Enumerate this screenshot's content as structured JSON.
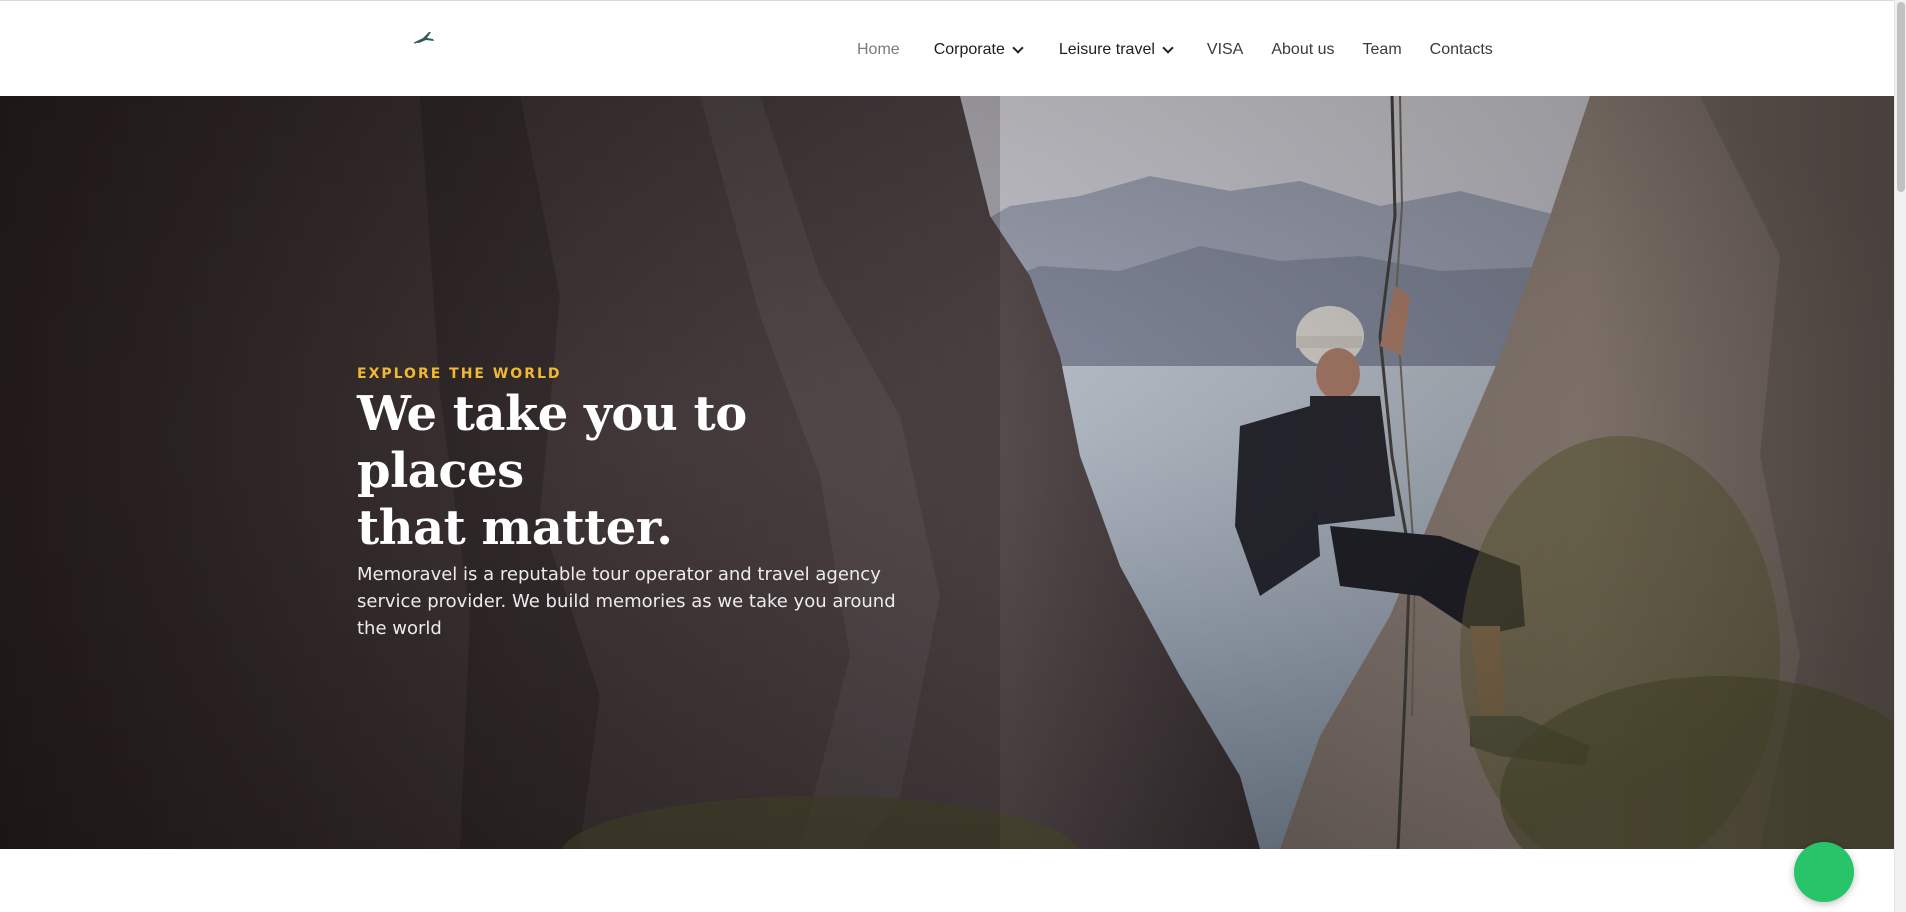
{
  "nav": {
    "items": [
      {
        "label": "Home",
        "active": true
      },
      {
        "label": "Corporate",
        "has_dropdown": true
      },
      {
        "label": "Leisure travel",
        "has_dropdown": true
      },
      {
        "label": "VISA"
      },
      {
        "label": "About us"
      },
      {
        "label": "Team"
      },
      {
        "label": "Contacts"
      }
    ]
  },
  "logo": {
    "icon": "airplane-logo-icon",
    "color": "#2e5e57"
  },
  "hero": {
    "kicker": "EXPLORE THE WORLD",
    "headline_line1": "We take you to places",
    "headline_line2": "that matter.",
    "description": "Memoravel is a reputable tour operator and travel agency service provider. We build memories as we take you around the world",
    "kicker_color": "#f0b933"
  },
  "chat_button": {
    "icon": "chat-bubble-icon",
    "color": "#27c46a"
  }
}
